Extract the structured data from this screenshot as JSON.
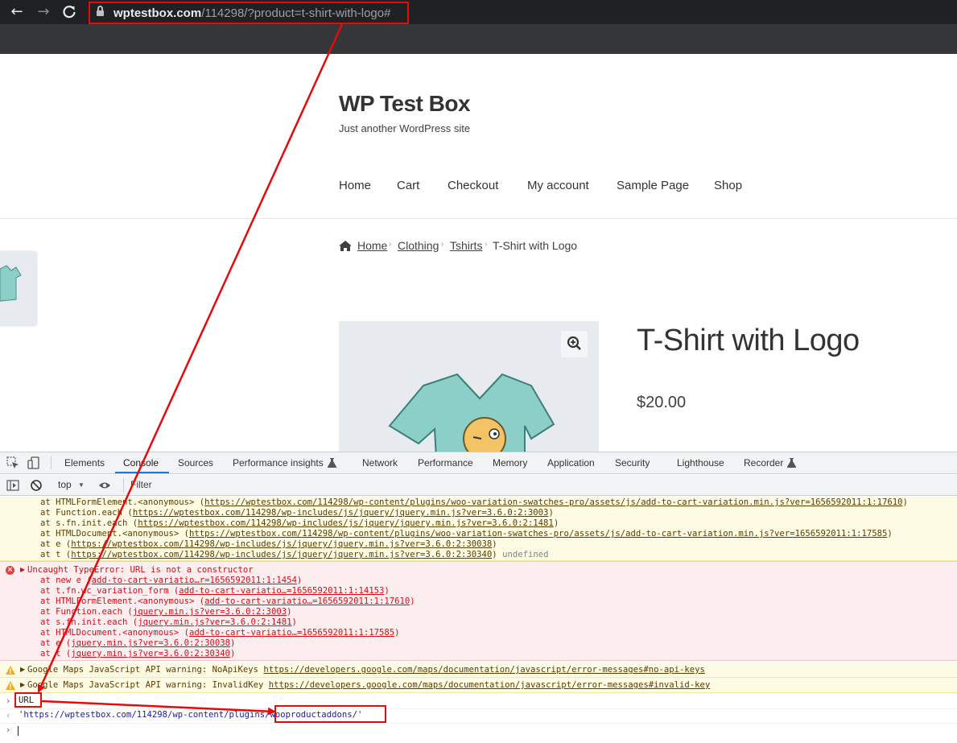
{
  "browser": {
    "url_host": "wptestbox.com",
    "url_path": "/114298/?product=t-shirt-with-logo#",
    "icons": [
      "back-icon",
      "forward-icon",
      "reload-icon",
      "lock-icon"
    ]
  },
  "site": {
    "title": "WP Test Box",
    "tagline": "Just another WordPress site",
    "nav": [
      "Home",
      "Cart",
      "Checkout",
      "My account",
      "Sample Page",
      "Shop"
    ],
    "breadcrumb": {
      "items": [
        "Home",
        "Clothing",
        "Tshirts"
      ],
      "current": "T-Shirt with Logo"
    },
    "product": {
      "title": "T-Shirt with Logo",
      "price": "$20.00"
    }
  },
  "devtools": {
    "tabs": [
      "Elements",
      "Console",
      "Sources",
      "Performance insights",
      "Network",
      "Performance",
      "Memory",
      "Application",
      "Security",
      "Lighthouse",
      "Recorder"
    ],
    "active_tab": "Console",
    "context": "top",
    "filter_placeholder": "Filter",
    "warn_stack": [
      {
        "pre": "at HTMLFormElement.<anonymous> (",
        "link": "https://wptestbox.com/114298/wp-content/plugins/woo-variation-swatches-pro/assets/js/add-to-cart-variation.min.js?ver=1656592011:1:17610",
        "post": ")"
      },
      {
        "pre": "at Function.each (",
        "link": "https://wptestbox.com/114298/wp-includes/js/jquery/jquery.min.js?ver=3.6.0:2:3003",
        "post": ")"
      },
      {
        "pre": "at s.fn.init.each (",
        "link": "https://wptestbox.com/114298/wp-includes/js/jquery/jquery.min.js?ver=3.6.0:2:1481",
        "post": ")"
      },
      {
        "pre": "at HTMLDocument.<anonymous> (",
        "link": "https://wptestbox.com/114298/wp-content/plugins/woo-variation-swatches-pro/assets/js/add-to-cart-variation.min.js?ver=1656592011:1:17585",
        "post": ")"
      },
      {
        "pre": "at e (",
        "link": "https://wptestbox.com/114298/wp-includes/js/jquery/jquery.min.js?ver=3.6.0:2:30038",
        "post": ")"
      },
      {
        "pre": "at t (",
        "link": "https://wptestbox.com/114298/wp-includes/js/jquery/jquery.min.js?ver=3.6.0:2:30340",
        "post": ")",
        "suffix": "undefined"
      }
    ],
    "error": {
      "title": "Uncaught TypeError: URL is not a constructor",
      "stack": [
        {
          "pre": "at new e (",
          "link": "add-to-cart-variatio…r=1656592011:1:1454",
          "post": ")"
        },
        {
          "pre": "at t.fn.wc_variation_form (",
          "link": "add-to-cart-variatio…=1656592011:1:14153",
          "post": ")"
        },
        {
          "pre": "at HTMLFormElement.<anonymous> (",
          "link": "add-to-cart-variatio…=1656592011:1:17610",
          "post": ")"
        },
        {
          "pre": "at Function.each (",
          "link": "jquery.min.js?ver=3.6.0:2:3003",
          "post": ")"
        },
        {
          "pre": "at s.fn.init.each (",
          "link": "jquery.min.js?ver=3.6.0:2:1481",
          "post": ")"
        },
        {
          "pre": "at HTMLDocument.<anonymous> (",
          "link": "add-to-cart-variatio…=1656592011:1:17585",
          "post": ")"
        },
        {
          "pre": "at e (",
          "link": "jquery.min.js?ver=3.6.0:2:30038",
          "post": ")"
        },
        {
          "pre": "at t (",
          "link": "jquery.min.js?ver=3.6.0:2:30340",
          "post": ")"
        }
      ]
    },
    "warnings": [
      {
        "text": "Google Maps JavaScript API warning: NoApiKeys ",
        "link": "https://developers.google.com/maps/documentation/javascript/error-messages#no-api-keys"
      },
      {
        "text": "Google Maps JavaScript API warning: InvalidKey ",
        "link": "https://developers.google.com/maps/documentation/javascript/error-messages#invalid-key"
      }
    ],
    "input": "URL",
    "result_prefix": "'https://wptestbox.com/114298/wp-content/plugins/",
    "result_highlight": "wooproductaddons/'"
  },
  "colors": {
    "annotation_red": "#e8090b",
    "devtools_accent": "#1a73e8",
    "error_text": "#d50f1c",
    "warning_text": "#5c3c00"
  }
}
